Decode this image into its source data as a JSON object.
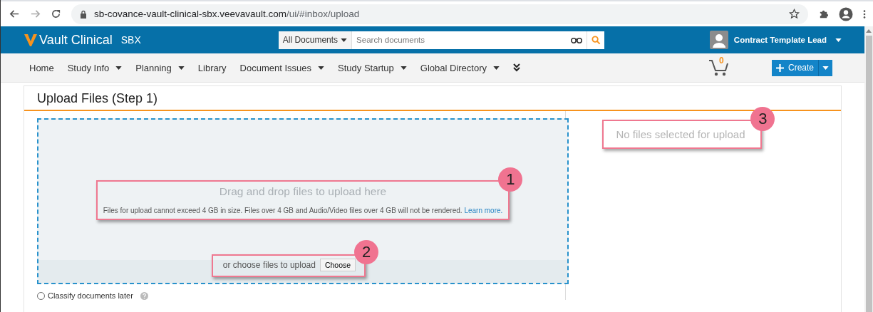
{
  "browser": {
    "url_host": "sb-covance-vault-clinical-sbx.veevavault.com",
    "url_path": "/ui/#inbox/upload"
  },
  "header": {
    "logo": "Vault Clinical",
    "environment": "SBX",
    "search_scope": "All Documents",
    "search_placeholder": "Search documents",
    "user": "Contract Template Lead"
  },
  "nav": [
    {
      "label": "Home",
      "has_menu": false
    },
    {
      "label": "Study Info",
      "has_menu": true
    },
    {
      "label": "Planning",
      "has_menu": true
    },
    {
      "label": "Library",
      "has_menu": false
    },
    {
      "label": "Document Issues",
      "has_menu": true
    },
    {
      "label": "Study Startup",
      "has_menu": true
    },
    {
      "label": "Global Directory",
      "has_menu": true
    }
  ],
  "cart_count": "0",
  "create_button": "Create",
  "page": {
    "title": "Upload Files (Step 1)",
    "drop_heading": "Drag and drop files to upload here",
    "drop_note": "Files for upload cannot exceed 4 GB in size. Files over 4 GB and Audio/Video files over 4 GB will not be rendered.",
    "learn_more": "Learn more.",
    "choose_prompt": "or choose files to upload",
    "choose_button": "Choose",
    "no_files": "No files selected for upload",
    "options": [
      {
        "label": "Classify documents later",
        "selected": false
      }
    ]
  },
  "callouts": [
    "1",
    "2",
    "3"
  ]
}
